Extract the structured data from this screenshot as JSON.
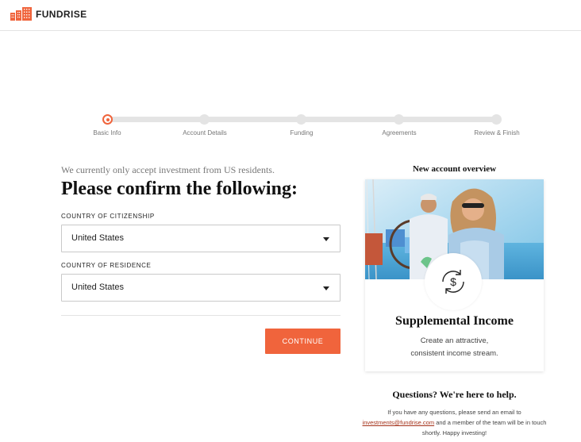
{
  "header": {
    "brand": "FUNDRISE",
    "brand_color": "#f0643c"
  },
  "progress": {
    "current_step": 0,
    "steps": [
      {
        "label": "Basic Info"
      },
      {
        "label": "Account Details"
      },
      {
        "label": "Funding"
      },
      {
        "label": "Agreements"
      },
      {
        "label": "Review & Finish"
      }
    ]
  },
  "form": {
    "intro": "We currently only accept investment from US residents.",
    "title": "Please confirm the following:",
    "citizenship_label": "COUNTRY OF CITIZENSHIP",
    "citizenship_value": "United States",
    "residence_label": "COUNTRY OF RESIDENCE",
    "residence_value": "United States",
    "continue_label": "CONTINUE"
  },
  "overview": {
    "title": "New account overview",
    "card_title": "Supplemental Income",
    "card_desc_line1": "Create an attractive,",
    "card_desc_line2": "consistent income stream.",
    "icon": "dollar-cycle-icon"
  },
  "help": {
    "title": "Questions? We're here to help.",
    "text_before": "If you have any questions, please send an email to",
    "email": "investments@fundrise.com",
    "text_after": "and a member of the team will be in touch shortly. Happy investing!"
  }
}
